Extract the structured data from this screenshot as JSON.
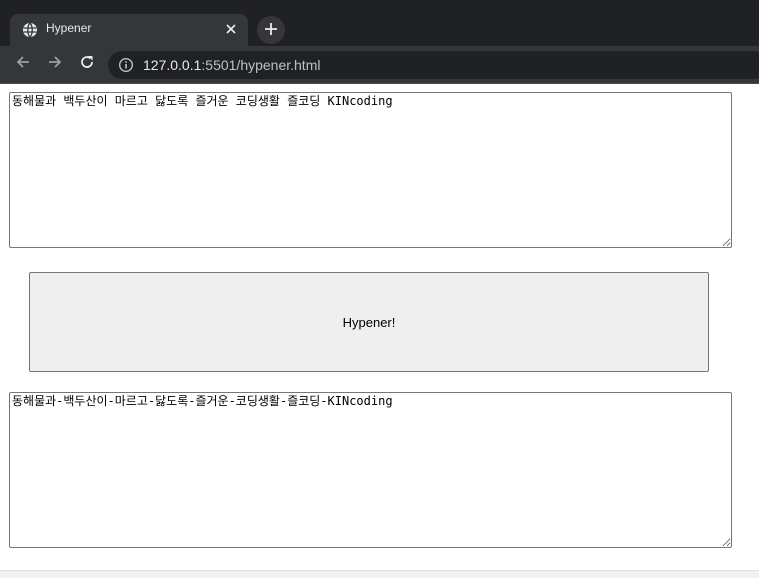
{
  "browser": {
    "tab": {
      "title": "Hypener",
      "favicon": "globe-icon",
      "close_icon": "close-icon"
    },
    "new_tab_icon": "plus-icon",
    "toolbar": {
      "back_icon": "arrow-left-icon",
      "forward_icon": "arrow-right-icon",
      "reload_icon": "reload-icon",
      "site_info_icon": "info-icon",
      "url_host": "127.0.0.1",
      "url_rest": ":5501/hypener.html"
    }
  },
  "page": {
    "input_text": "동해물과 백두산이 마르고 닳도록 즐거운 코딩생활 즐코딩 KINcoding",
    "button_label": "Hypener!",
    "output_text": "동해물과-백두산이-마르고-닳도록-즐거운-코딩생활-즐코딩-KINcoding"
  },
  "colors": {
    "tabstrip_bg": "#202124",
    "toolbar_bg": "#35363a",
    "button_bg": "#efefef"
  }
}
